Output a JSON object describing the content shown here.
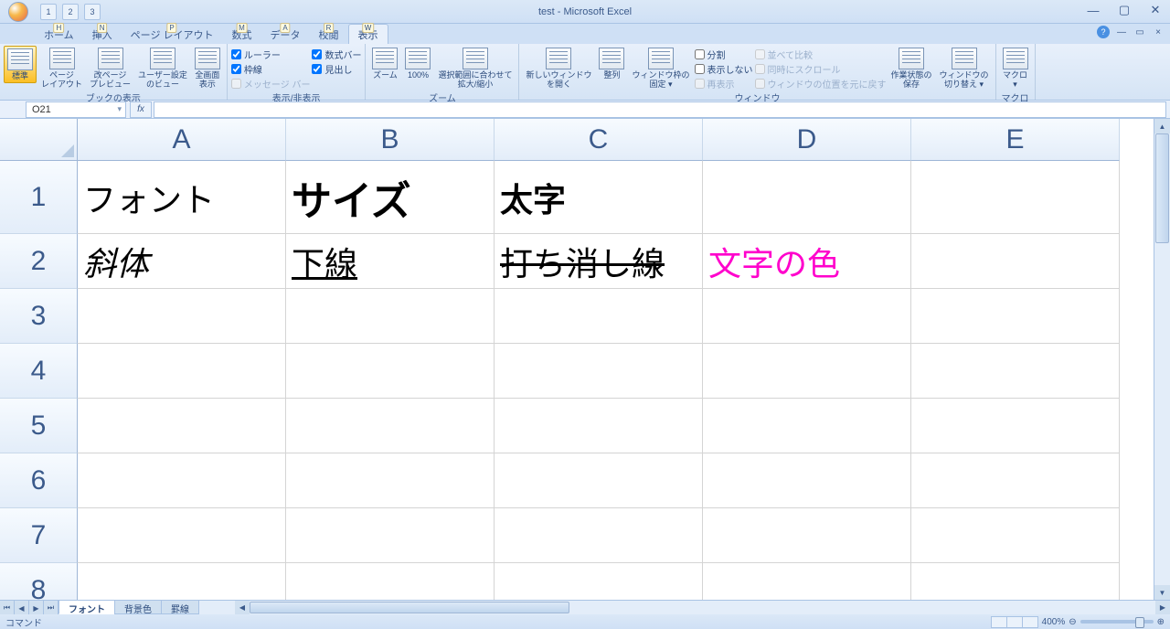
{
  "title": "test - Microsoft Excel",
  "qat": [
    "1",
    "2",
    "3"
  ],
  "tabs": [
    {
      "label": "ホーム",
      "key": "H"
    },
    {
      "label": "挿入",
      "key": "N"
    },
    {
      "label": "ページ レイアウト",
      "key": "P"
    },
    {
      "label": "数式",
      "key": "M"
    },
    {
      "label": "データ",
      "key": "A"
    },
    {
      "label": "校閲",
      "key": "R"
    },
    {
      "label": "表示",
      "key": "W",
      "active": true
    }
  ],
  "ribbon": {
    "groups": [
      {
        "label": "ブックの表示",
        "big": [
          {
            "l1": "標準",
            "l2": "",
            "active": true
          },
          {
            "l1": "ページ",
            "l2": "レイアウト"
          },
          {
            "l1": "改ページ",
            "l2": "プレビュー"
          },
          {
            "l1": "ユーザー設定",
            "l2": "のビュー"
          },
          {
            "l1": "全画面",
            "l2": "表示"
          }
        ]
      },
      {
        "label": "表示/非表示",
        "checks": [
          {
            "label": "ルーラー",
            "on": true
          },
          {
            "label": "数式バー",
            "on": true
          },
          {
            "label": "枠線",
            "on": true
          },
          {
            "label": "見出し",
            "on": true
          },
          {
            "label": "メッセージ バー",
            "on": false
          }
        ]
      },
      {
        "label": "ズーム",
        "big": [
          {
            "l1": "ズーム",
            "l2": ""
          },
          {
            "l1": "100%",
            "l2": ""
          },
          {
            "l1": "選択範囲に合わせて",
            "l2": "拡大/縮小"
          }
        ]
      },
      {
        "label": "ウィンドウ",
        "big": [
          {
            "l1": "新しいウィンドウ",
            "l2": "を開く"
          },
          {
            "l1": "整列",
            "l2": ""
          },
          {
            "l1": "ウィンドウ枠の",
            "l2": "固定 ▾"
          }
        ],
        "checks2": [
          {
            "label": "分割"
          },
          {
            "label": "表示しない"
          },
          {
            "label": "再表示"
          }
        ],
        "checks3": [
          {
            "label": "並べて比較"
          },
          {
            "label": "同時にスクロール"
          },
          {
            "label": "ウィンドウの位置を元に戻す"
          }
        ],
        "big2": [
          {
            "l1": "作業状態の",
            "l2": "保存"
          },
          {
            "l1": "ウィンドウの",
            "l2": "切り替え ▾"
          }
        ]
      },
      {
        "label": "マクロ",
        "big": [
          {
            "l1": "マクロ",
            "l2": "▾"
          }
        ]
      }
    ]
  },
  "namebox": "O21",
  "columns": [
    "A",
    "B",
    "C",
    "D",
    "E"
  ],
  "row_count": 8,
  "cells": {
    "A1": {
      "t": "フォント"
    },
    "B1": {
      "t": "サイズ",
      "cls": "st-bold",
      "size": 44
    },
    "C1": {
      "t": "太字",
      "cls": "st-bold"
    },
    "A2": {
      "t": "斜体",
      "cls": "st-italic"
    },
    "B2": {
      "t": "下線",
      "cls": "st-underline"
    },
    "C2": {
      "t": "打ち消し線",
      "cls": "st-strike"
    },
    "D2": {
      "t": "文字の色",
      "color": "#ff00cc"
    }
  },
  "sheets": [
    {
      "name": "フォント",
      "active": true
    },
    {
      "name": "背景色"
    },
    {
      "name": "罫線"
    }
  ],
  "status_left": "コマンド",
  "zoom": "400%"
}
